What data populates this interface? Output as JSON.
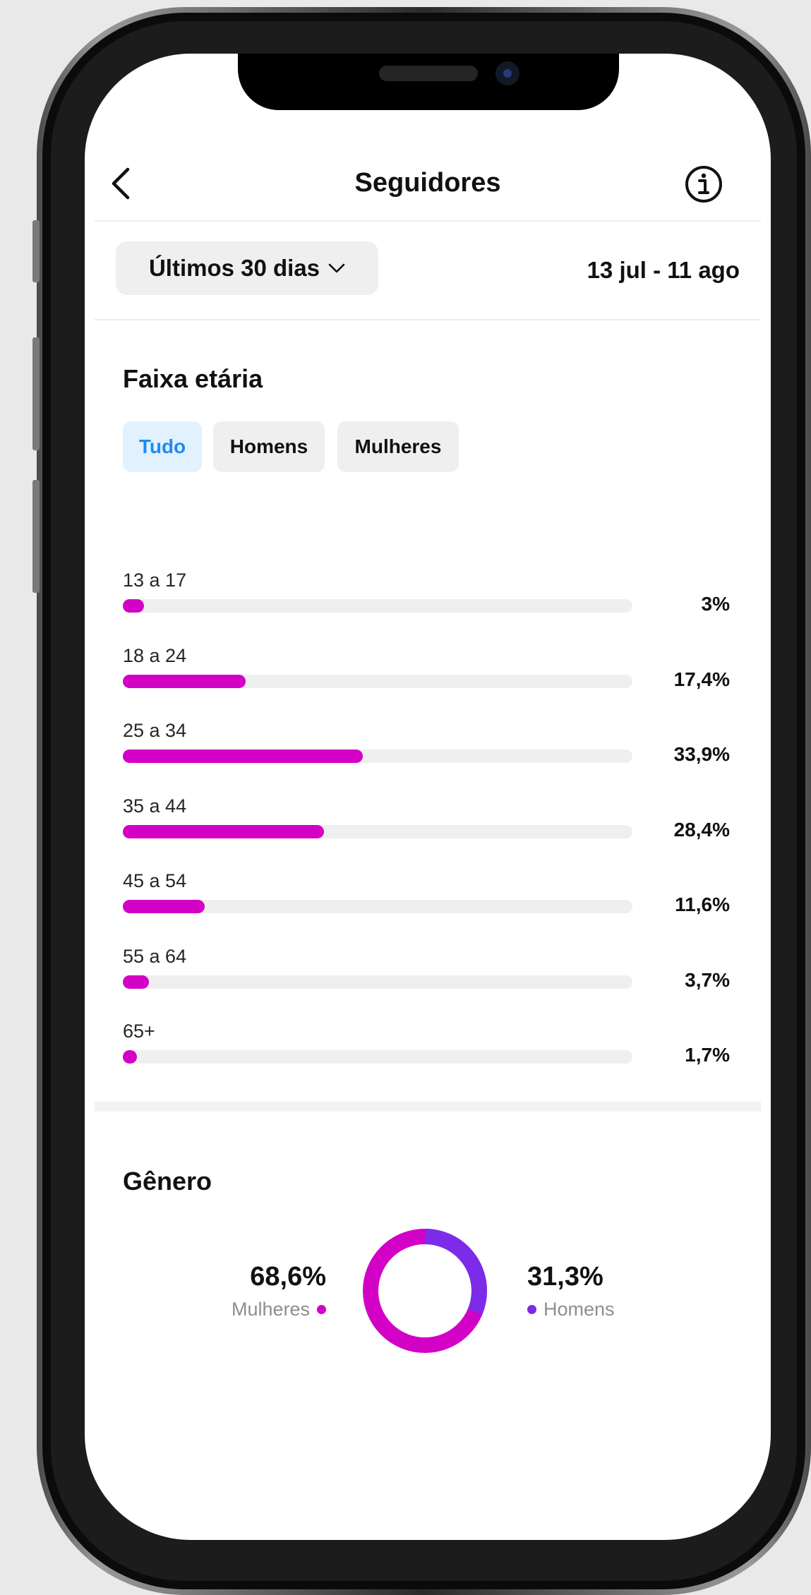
{
  "header": {
    "title": "Seguidores"
  },
  "filter": {
    "period_label": "Últimos 30 dias",
    "date_range": "13 jul - 11 ago"
  },
  "age_section": {
    "title": "Faixa etária",
    "tabs": [
      {
        "label": "Tudo",
        "active": true
      },
      {
        "label": "Homens",
        "active": false
      },
      {
        "label": "Mulheres",
        "active": false
      }
    ],
    "rows": [
      {
        "label": "13 a 17",
        "value_text": "3%",
        "value": 3.0
      },
      {
        "label": "18 a 24",
        "value_text": "17,4%",
        "value": 17.4
      },
      {
        "label": "25 a 34",
        "value_text": "33,9%",
        "value": 33.9
      },
      {
        "label": "35 a 44",
        "value_text": "28,4%",
        "value": 28.4
      },
      {
        "label": "45 a 54",
        "value_text": "11,6%",
        "value": 11.6
      },
      {
        "label": "55 a 64",
        "value_text": "3,7%",
        "value": 3.7
      },
      {
        "label": "65+",
        "value_text": "1,7%",
        "value": 1.7
      }
    ]
  },
  "gender_section": {
    "title": "Gênero",
    "women": {
      "pct_text": "68,6%",
      "label": "Mulheres",
      "value": 68.6
    },
    "men": {
      "pct_text": "31,3%",
      "label": "Homens",
      "value": 31.3
    }
  },
  "colors": {
    "accent_magenta": "#d300c5",
    "accent_purple": "#7c2be8",
    "tab_active_bg": "#e1f1fd",
    "tab_active_text": "#1d8cf0",
    "track": "#efefef"
  },
  "icons": {
    "back": "chevron-left-icon",
    "info": "info-circle-icon",
    "dropdown": "chevron-down-icon"
  }
}
